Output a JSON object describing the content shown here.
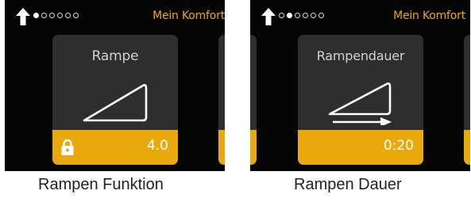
{
  "colors": {
    "accent": "#e9a80b",
    "header_text": "#f0a800",
    "card_bg": "#2e2e2e",
    "screen_bg": "#050505"
  },
  "screens": [
    {
      "header": {
        "title": "Mein Komfort",
        "icon": "back-arrow-icon",
        "page_count": 6,
        "active_page": 1
      },
      "card": {
        "label": "Rampe",
        "value": "4.0",
        "icon": "ramp-icon",
        "footer_icon": "lock-icon"
      },
      "caption": "Rampen Funktion"
    },
    {
      "header": {
        "title": "Mein Komfort",
        "icon": "back-arrow-icon",
        "page_count": 6,
        "active_page": 2
      },
      "card": {
        "label": "Rampendauer",
        "value": "0:20",
        "icon": "ramp-duration-icon"
      },
      "caption": "Rampen Dauer"
    }
  ]
}
